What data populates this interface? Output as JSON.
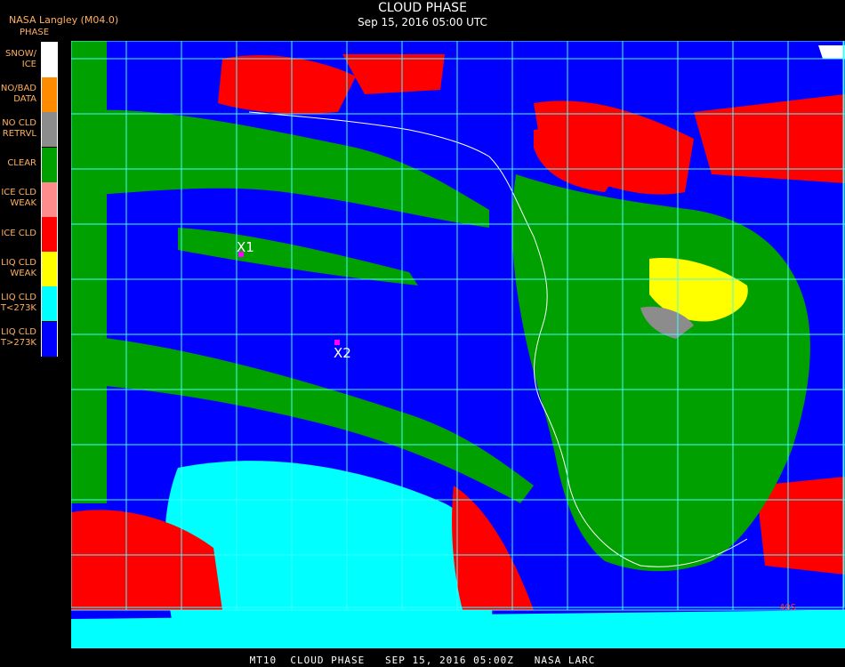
{
  "header": {
    "agency": "NASA Langley (M04.0)",
    "title": "CLOUD PHASE",
    "subtitle": "Sep 15, 2016 05:00 UTC"
  },
  "legend": {
    "title": "PHASE",
    "items": [
      {
        "label": "SNOW/\n ICE",
        "color": "#ffffff"
      },
      {
        "label": "NO/BAD\nDATA",
        "color": "#ff8c00"
      },
      {
        "label": "NO CLD\nRETRVL",
        "color": "#8c8c8c"
      },
      {
        "label": "CLEAR",
        "color": "#00a000"
      },
      {
        "label": "ICE CLD\nWEAK",
        "color": "#ff8c8c"
      },
      {
        "label": "ICE CLD",
        "color": "#ff0000"
      },
      {
        "label": "LIQ CLD\nWEAK",
        "color": "#ffff00"
      },
      {
        "label": "LIQ CLD\nT<273K",
        "color": "#00ffff"
      },
      {
        "label": "LIQ CLD\nT>273K",
        "color": "#0000ff"
      }
    ]
  },
  "markers": [
    {
      "label": "X1",
      "color": "#ff00ff"
    },
    {
      "label": "X2",
      "color": "#ff00ff"
    }
  ],
  "grid_label": "40S",
  "footer": "MT10  CLOUD PHASE   SEP 15, 2016 05:00Z   NASA LARC"
}
